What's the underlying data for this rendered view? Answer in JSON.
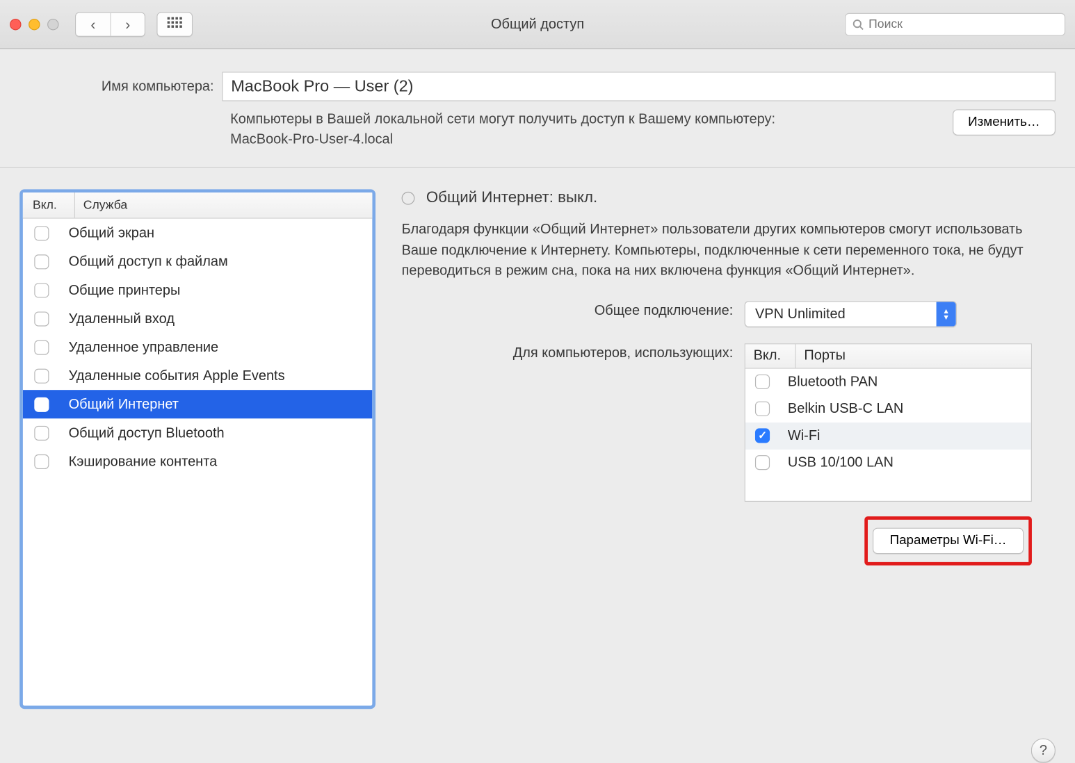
{
  "window": {
    "title": "Общий доступ",
    "search_placeholder": "Поиск"
  },
  "computer_name": {
    "label": "Имя компьютера:",
    "value": "MacBook Pro — User (2)",
    "description": "Компьютеры в Вашей локальной сети могут получить доступ к Вашему компьютеру: MacBook-Pro-User-4.local",
    "edit_button": "Изменить…"
  },
  "services": {
    "header_on": "Вкл.",
    "header_service": "Служба",
    "items": [
      {
        "label": "Общий экран",
        "checked": false,
        "selected": false
      },
      {
        "label": "Общий доступ к файлам",
        "checked": false,
        "selected": false
      },
      {
        "label": "Общие принтеры",
        "checked": false,
        "selected": false
      },
      {
        "label": "Удаленный вход",
        "checked": false,
        "selected": false
      },
      {
        "label": "Удаленное управление",
        "checked": false,
        "selected": false
      },
      {
        "label": "Удаленные события Apple Events",
        "checked": false,
        "selected": false
      },
      {
        "label": "Общий Интернет",
        "checked": false,
        "selected": true
      },
      {
        "label": "Общий доступ Bluetooth",
        "checked": false,
        "selected": false
      },
      {
        "label": "Кэширование контента",
        "checked": false,
        "selected": false
      }
    ]
  },
  "detail": {
    "status": "Общий Интернет: выкл.",
    "description": "Благодаря функции «Общий Интернет» пользователи других компьютеров смогут использовать Ваше подключение к Интернету. Компьютеры, подключенные к сети переменного тока, не будут переводиться в режим сна, пока на них включена функция «Общий Интернет».",
    "share_from_label": "Общее подключение:",
    "share_from_value": "VPN Unlimited",
    "to_computers_label": "Для компьютеров, использующих:",
    "ports_header_on": "Вкл.",
    "ports_header_ports": "Порты",
    "ports": [
      {
        "label": "Bluetooth PAN",
        "checked": false,
        "hl": false
      },
      {
        "label": "Belkin USB-C LAN",
        "checked": false,
        "hl": false
      },
      {
        "label": "Wi-Fi",
        "checked": true,
        "hl": true
      },
      {
        "label": "USB 10/100 LAN",
        "checked": false,
        "hl": false
      }
    ],
    "wifi_options_button": "Параметры Wi-Fi…"
  },
  "help_label": "?"
}
